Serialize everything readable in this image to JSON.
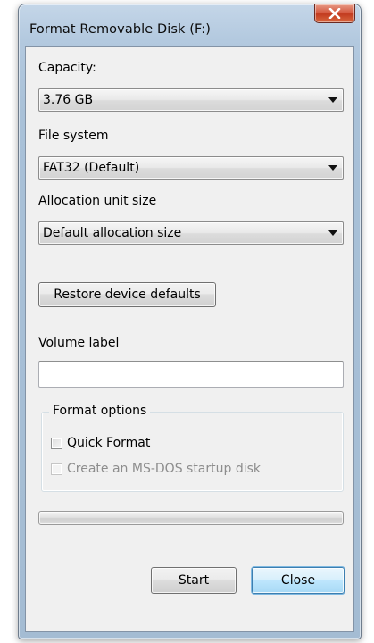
{
  "window": {
    "title": "Format Removable Disk (F:)",
    "close_icon": "close-icon",
    "close_color": "#c8442a"
  },
  "capacity": {
    "label": "Capacity:",
    "value": "3.76 GB"
  },
  "file_system": {
    "label": "File system",
    "value": "FAT32 (Default)"
  },
  "allocation": {
    "label": "Allocation unit size",
    "value": "Default allocation size"
  },
  "restore_button": "Restore device defaults",
  "volume_label": {
    "label": "Volume label",
    "value": ""
  },
  "format_options": {
    "title": "Format options",
    "quick_format": {
      "label": "Quick Format",
      "checked": false
    },
    "msdos_startup": {
      "label": "Create an MS-DOS startup disk",
      "checked": false,
      "enabled": false
    }
  },
  "progress": {
    "percent": 0
  },
  "buttons": {
    "start": "Start",
    "close": "Close"
  }
}
